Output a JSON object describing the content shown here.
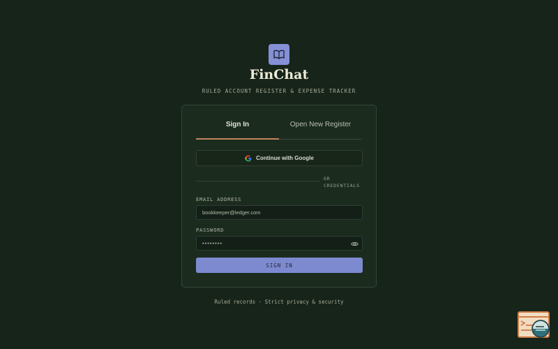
{
  "app": {
    "title": "FinChat",
    "subtitle": "RULED ACCOUNT REGISTER & EXPENSE TRACKER",
    "logo_icon": "open-book-icon",
    "accent_color": "#8590d6"
  },
  "tabs": [
    {
      "label": "Sign In",
      "active": true
    },
    {
      "label": "Open New Register",
      "active": false
    }
  ],
  "google": {
    "label": "Continue with Google",
    "icon": "google-icon"
  },
  "divider": {
    "line1": "OR",
    "line2": "CREDENTIALS"
  },
  "email": {
    "label": "EMAIL ADDRESS",
    "value": "bookkeeper@ledger.com"
  },
  "password": {
    "label": "PASSWORD",
    "value": "••••••••",
    "toggle_icon": "eye-icon"
  },
  "submit": {
    "label": "SIGN IN"
  },
  "footer": {
    "text": "Ruled records · Strict privacy & security"
  },
  "widget": {
    "icon": "terminal-chat-icon"
  }
}
